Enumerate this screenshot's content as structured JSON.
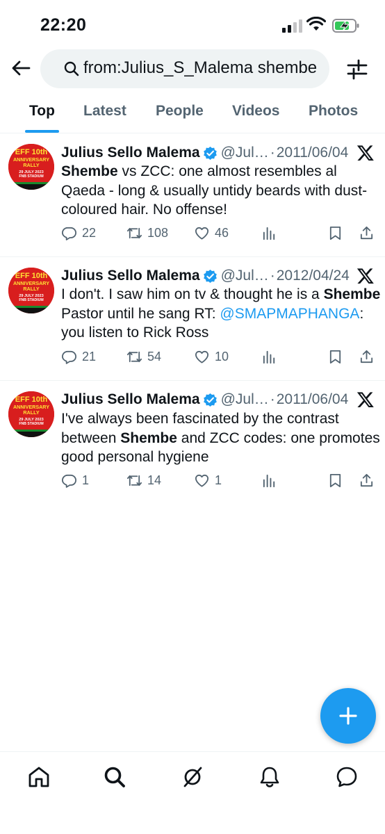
{
  "status": {
    "time": "22:20"
  },
  "search": {
    "query": "from:Julius_S_Malema shembe"
  },
  "tabs": [
    {
      "label": "Top",
      "active": true
    },
    {
      "label": "Latest",
      "active": false
    },
    {
      "label": "People",
      "active": false
    },
    {
      "label": "Videos",
      "active": false
    },
    {
      "label": "Photos",
      "active": false
    }
  ],
  "avatar_text": {
    "line1": "EFF 10th",
    "line2": "ANNIVERSARY",
    "line3": "RALLY",
    "line4": "29 JULY 2023",
    "line5": "FNB STADIUM"
  },
  "tweets": [
    {
      "author": "Julius Sello Malema",
      "handle": "@Jul…",
      "separator": "·",
      "date": "2011/06/04",
      "text_parts": [
        "Shembe",
        " vs ZCC: one almost resembles al Qaeda - long & usually untidy beards with dust-coloured hair. No offense!"
      ],
      "replies": "22",
      "retweets": "108",
      "likes": "46"
    },
    {
      "author": "Julius Sello Malema",
      "handle": "@Jul…",
      "separator": "·",
      "date": "2012/04/24",
      "text_parts": [
        "I don't. I saw him on tv & thought he is a ",
        "Shembe",
        " Pastor until he sang RT: ",
        "@SMAPMAPHANGA",
        ":  you listen to Rick Ross"
      ],
      "replies": "21",
      "retweets": "54",
      "likes": "10"
    },
    {
      "author": "Julius Sello Malema",
      "handle": "@Jul…",
      "separator": "·",
      "date": "2011/06/04",
      "text_parts": [
        "I've always been fascinated by the contrast between ",
        "Shembe",
        " and ZCC codes: one promotes good personal hygiene"
      ],
      "replies": "1",
      "retweets": "14",
      "likes": "1"
    }
  ],
  "colors": {
    "accent": "#1d9bf0",
    "text": "#0f1419",
    "muted": "#536471",
    "avatar_red": "#d81e1e"
  },
  "icons": {
    "back": "arrow-left-icon",
    "search": "search-icon",
    "filter": "sliders-icon",
    "verified": "verified-badge-icon",
    "x": "x-logo-icon",
    "reply": "reply-icon",
    "retweet": "retweet-icon",
    "like": "heart-icon",
    "views": "views-icon",
    "bookmark": "bookmark-icon",
    "share": "share-icon",
    "compose": "plus-icon",
    "nav": [
      "home-icon",
      "search-icon",
      "grok-icon",
      "notifications-icon",
      "messages-icon"
    ]
  }
}
